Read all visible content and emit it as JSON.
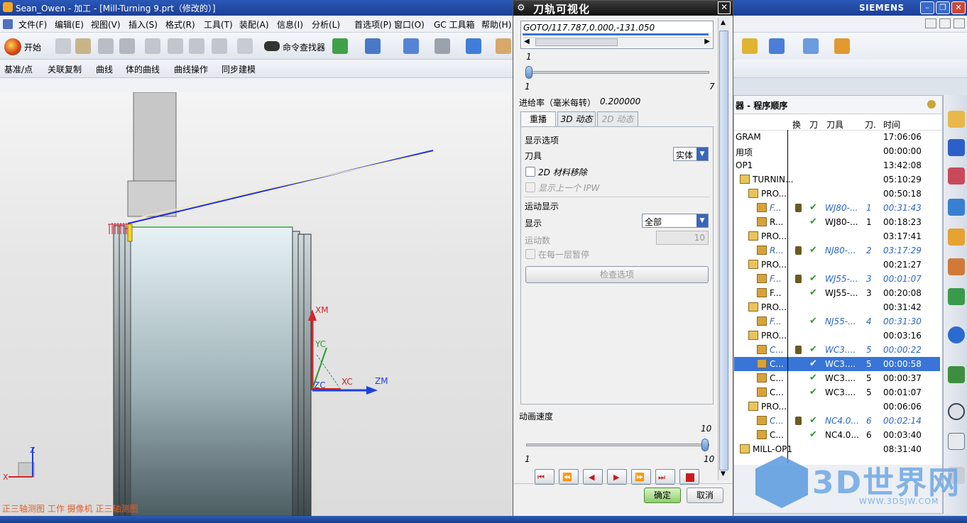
{
  "window": {
    "title": "Sean_Owen - 加工 - [Mill-Turning 9.prt（修改的）]",
    "brand": "SIEMENS"
  },
  "menu": [
    "文件(F)",
    "编辑(E)",
    "视图(V)",
    "插入(S)",
    "格式(R)",
    "工具(T)",
    "装配(A)",
    "信息(I)",
    "分析(L)",
    "首选项(P)",
    "窗口(O)",
    "GC 工具箱",
    "帮助(H)"
  ],
  "toolbar": {
    "start": "开始",
    "command_finder": "命令查找器"
  },
  "toolbar2": [
    "基准/点",
    "关联复制",
    "曲线",
    "体的曲线",
    "曲线操作",
    "同步建模"
  ],
  "viewport": {
    "axis_labels": {
      "xm": "XM",
      "yc": "YC",
      "zm": "ZM",
      "xc": "XC",
      "zc": "ZC"
    },
    "triad": {
      "z": "Z",
      "x": "X"
    },
    "status": "正三轴测图 工作 摄像机 正三轴测图"
  },
  "dialog": {
    "title": "刀轨可视化",
    "goto_line": "GOTO/117.787,0.000,-131.050",
    "slider_top": {
      "value": "1",
      "min": "1",
      "max": "7"
    },
    "feed_label": "进给率（毫米每转）",
    "feed_value": "0.200000",
    "tabs": [
      "重播",
      "3D 动态",
      "2D 动态"
    ],
    "display_options": "显示选项",
    "tool_label": "刀具",
    "tool_value": "实体",
    "material_removal": "2D 材料移除",
    "show_prev_ipw": "显示上一个 IPW",
    "motion_display": "运动显示",
    "display_label": "显示",
    "display_value": "全部",
    "motion_count_label": "运动数",
    "motion_count_value": "10",
    "pause_each_layer": "在每一层暂停",
    "check_options": "检查选项",
    "anim_speed": "动画速度",
    "speed": {
      "value": "10",
      "min": "1",
      "max": "10"
    },
    "ok": "确定",
    "cancel": "取消"
  },
  "navigator": {
    "title": "器 - 程序顺序",
    "headers": [
      "换",
      "刀",
      "刀具",
      "刀.",
      "时间"
    ],
    "rows": [
      {
        "name": "GRAM",
        "tool": "",
        "num": "",
        "time": "17:06:06",
        "style": "plain",
        "chg": false,
        "ok": false
      },
      {
        "name": "用项",
        "tool": "",
        "num": "",
        "time": "00:00:00",
        "style": "plain",
        "chg": false,
        "ok": false
      },
      {
        "name": "OP1",
        "tool": "",
        "num": "",
        "time": "13:42:08",
        "style": "plain",
        "chg": false,
        "ok": false
      },
      {
        "name": "TURNIN...",
        "tool": "",
        "num": "",
        "time": "05:10:29",
        "style": "plain",
        "chg": false,
        "ok": false
      },
      {
        "name": "PRO...",
        "tool": "",
        "num": "",
        "time": "00:50:18",
        "style": "plain",
        "chg": false,
        "ok": false
      },
      {
        "name": "F...",
        "tool": "WJ80-...",
        "num": "1",
        "time": "00:31:43",
        "style": "blue",
        "chg": true,
        "ok": true
      },
      {
        "name": "R...",
        "tool": "WJ80-...",
        "num": "1",
        "time": "00:18:23",
        "style": "plain",
        "chg": false,
        "ok": true
      },
      {
        "name": "PRO...",
        "tool": "",
        "num": "",
        "time": "03:17:41",
        "style": "plain",
        "chg": false,
        "ok": false
      },
      {
        "name": "R...",
        "tool": "NJ80-...",
        "num": "2",
        "time": "03:17:29",
        "style": "blue",
        "chg": true,
        "ok": true
      },
      {
        "name": "PRO...",
        "tool": "",
        "num": "",
        "time": "00:21:27",
        "style": "plain",
        "chg": false,
        "ok": false
      },
      {
        "name": "F...",
        "tool": "WJ55-...",
        "num": "3",
        "time": "00:01:07",
        "style": "blue",
        "chg": true,
        "ok": true
      },
      {
        "name": "F...",
        "tool": "WJ55-...",
        "num": "3",
        "time": "00:20:08",
        "style": "plain",
        "chg": false,
        "ok": true
      },
      {
        "name": "PRO...",
        "tool": "",
        "num": "",
        "time": "00:31:42",
        "style": "plain",
        "chg": false,
        "ok": false
      },
      {
        "name": "F...",
        "tool": "NJ55-...",
        "num": "4",
        "time": "00:31:30",
        "style": "blue",
        "chg": false,
        "ok": true
      },
      {
        "name": "PRO...",
        "tool": "",
        "num": "",
        "time": "00:03:16",
        "style": "plain",
        "chg": false,
        "ok": false
      },
      {
        "name": "C...",
        "tool": "WC3....",
        "num": "5",
        "time": "00:00:22",
        "style": "blue",
        "chg": true,
        "ok": true
      },
      {
        "name": "C...",
        "tool": "WC3....",
        "num": "5",
        "time": "00:00:58",
        "style": "sel",
        "chg": false,
        "ok": true
      },
      {
        "name": "C...",
        "tool": "WC3....",
        "num": "5",
        "time": "00:00:37",
        "style": "plain",
        "chg": false,
        "ok": true
      },
      {
        "name": "C...",
        "tool": "WC3....",
        "num": "5",
        "time": "00:01:07",
        "style": "plain",
        "chg": false,
        "ok": true
      },
      {
        "name": "PRO...",
        "tool": "",
        "num": "",
        "time": "00:06:06",
        "style": "plain",
        "chg": false,
        "ok": false
      },
      {
        "name": "C...",
        "tool": "NC4.0...",
        "num": "6",
        "time": "00:02:14",
        "style": "blue",
        "chg": true,
        "ok": true
      },
      {
        "name": "C...",
        "tool": "NC4.0...",
        "num": "6",
        "time": "00:03:40",
        "style": "plain",
        "chg": false,
        "ok": true
      },
      {
        "name": "MILL-OP1",
        "tool": "",
        "num": "",
        "time": "08:31:40",
        "style": "plain",
        "chg": false,
        "ok": false
      }
    ]
  },
  "watermark": {
    "text": "3D世界网",
    "url": "WWW.3DSJW.COM"
  }
}
